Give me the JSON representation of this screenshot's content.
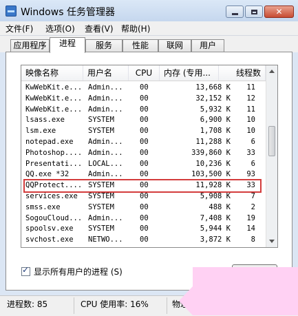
{
  "window": {
    "title": "Windows 任务管理器"
  },
  "menu": [
    "文件(F)",
    "选项(O)",
    "查看(V)",
    "帮助(H)"
  ],
  "tabs": [
    "应用程序",
    "进程",
    "服务",
    "性能",
    "联网",
    "用户"
  ],
  "active_tab": "进程",
  "columns": [
    "映像名称",
    "用户名",
    "CPU",
    "内存 (专用...",
    "线程数"
  ],
  "rows": [
    {
      "image": "KwWebKit.e...",
      "user": "Admin...",
      "cpu": "00",
      "mem": "13,668 K",
      "threads": "11"
    },
    {
      "image": "KwWebKit.e...",
      "user": "Admin...",
      "cpu": "00",
      "mem": "32,152 K",
      "threads": "12"
    },
    {
      "image": "KwWebKit.e...",
      "user": "Admin...",
      "cpu": "00",
      "mem": "5,932 K",
      "threads": "11"
    },
    {
      "image": "lsass.exe",
      "user": "SYSTEM",
      "cpu": "00",
      "mem": "6,900 K",
      "threads": "10"
    },
    {
      "image": "lsm.exe",
      "user": "SYSTEM",
      "cpu": "00",
      "mem": "1,708 K",
      "threads": "10"
    },
    {
      "image": "notepad.exe",
      "user": "Admin...",
      "cpu": "00",
      "mem": "11,288 K",
      "threads": "6"
    },
    {
      "image": "Photoshop....",
      "user": "Admin...",
      "cpu": "00",
      "mem": "339,860 K",
      "threads": "33"
    },
    {
      "image": "Presentati...",
      "user": "LOCAL...",
      "cpu": "00",
      "mem": "10,236 K",
      "threads": "6"
    },
    {
      "image": "QQ.exe *32",
      "user": "Admin...",
      "cpu": "00",
      "mem": "103,500 K",
      "threads": "93"
    },
    {
      "image": "QQProtect....",
      "user": "SYSTEM",
      "cpu": "00",
      "mem": "11,928 K",
      "threads": "33"
    },
    {
      "image": "services.exe",
      "user": "SYSTEM",
      "cpu": "00",
      "mem": "5,908 K",
      "threads": "7"
    },
    {
      "image": "smss.exe",
      "user": "SYSTEM",
      "cpu": "00",
      "mem": "488 K",
      "threads": "2"
    },
    {
      "image": "SogouCloud...",
      "user": "Admin...",
      "cpu": "00",
      "mem": "7,408 K",
      "threads": "19"
    },
    {
      "image": "spoolsv.exe",
      "user": "SYSTEM",
      "cpu": "00",
      "mem": "5,944 K",
      "threads": "14"
    },
    {
      "image": "svchost.exe",
      "user": "NETWO...",
      "cpu": "00",
      "mem": "3,872 K",
      "threads": "8"
    }
  ],
  "show_all_label": "显示所有用户的进程 (S)",
  "show_all_checked": true,
  "status": {
    "processes": "进程数: 85",
    "cpu": "CPU 使用率: 16%",
    "memory": "物理"
  },
  "colors": {
    "highlight_border": "#d33b3b",
    "overlay": "#ffd1f3"
  }
}
